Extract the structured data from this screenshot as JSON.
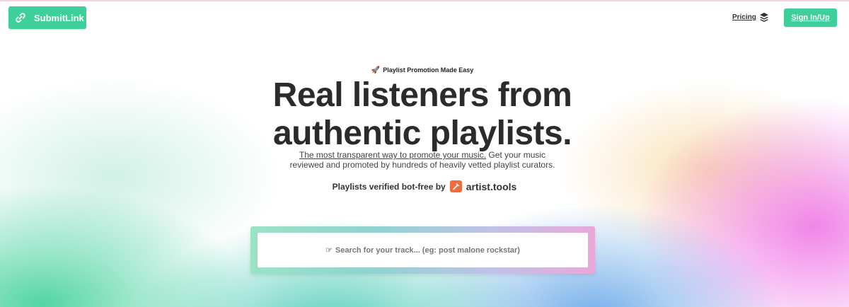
{
  "colors": {
    "brand": "#3ecf9a",
    "artist_tools": "#f06b3c",
    "text_dark": "#2b2b2b"
  },
  "header": {
    "logo_label": "SubmitLink",
    "logo_icon": "link-icon",
    "pricing_label": "Pricing",
    "stack_icon": "layers-icon",
    "signin_label": "Sign In/Up"
  },
  "hero": {
    "tagline_icon": "rocket-icon",
    "tagline": "Playlist Promotion Made Easy",
    "headline_line1": "Real listeners from",
    "headline_line2": "authentic playlists.",
    "sub_underlined": "The most transparent way to promote your music.",
    "sub_rest_1": " Get your music",
    "sub_rest_2": "reviewed and promoted by hundreds of heavily vetted playlist curators.",
    "verified_text": "Playlists verified bot-free by",
    "verified_logo_icon": "hammer-icon",
    "verified_brand": "artist.tools"
  },
  "search": {
    "icon": "pointing-hand-icon",
    "placeholder": "Search for your track... (eg: post malone rockstar)"
  }
}
